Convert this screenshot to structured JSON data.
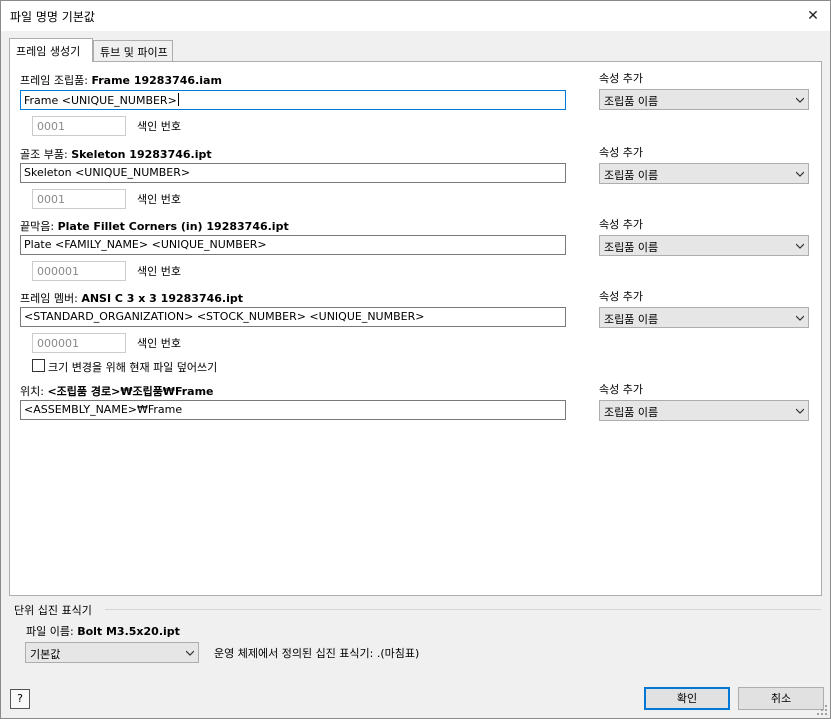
{
  "window": {
    "title": "파일 명명 기본값",
    "close_glyph": "✕"
  },
  "tabs": [
    {
      "label": "프레임 생성기"
    },
    {
      "label": "튜브 및 파이프"
    }
  ],
  "rows": [
    {
      "label_prefix": "프레임 조립품:",
      "label_value": "Frame 19283746.iam",
      "value": "Frame <UNIQUE_NUMBER>",
      "index_value": "0001",
      "index_label": "색인 번호",
      "attr_label": "속성 추가",
      "attr_selected": "조립품 이름"
    },
    {
      "label_prefix": "골조 부품:",
      "label_value": "Skeleton 19283746.ipt",
      "value": "Skeleton <UNIQUE_NUMBER>",
      "index_value": "0001",
      "index_label": "색인 번호",
      "attr_label": "속성 추가",
      "attr_selected": "조립품 이름"
    },
    {
      "label_prefix": "끝막음:",
      "label_value": "Plate Fillet Corners (in) 19283746.ipt",
      "value": "Plate <FAMILY_NAME> <UNIQUE_NUMBER>",
      "index_value": "000001",
      "index_label": "색인 번호",
      "attr_label": "속성 추가",
      "attr_selected": "조립품 이름"
    },
    {
      "label_prefix": "프레임 멤버:",
      "label_value": "ANSI C 3 x 3 19283746.ipt",
      "value": "<STANDARD_ORGANIZATION> <STOCK_NUMBER> <UNIQUE_NUMBER>",
      "index_value": "000001",
      "index_label": "색인 번호",
      "attr_label": "속성 추가",
      "attr_selected": "조립품 이름"
    }
  ],
  "overwrite_checkbox": {
    "label": "크기 변경을 위해 현재 파일 덮어쓰기",
    "checked": false
  },
  "location": {
    "label_prefix": "위치:",
    "label_value": "<조립품 경로>₩조립품₩Frame",
    "value": "<ASSEMBLY_NAME>₩Frame",
    "attr_label": "속성 추가",
    "attr_selected": "조립품 이름"
  },
  "unit_separator": {
    "group_title": "단위 십진 표식기",
    "file_name_prefix": "파일 이름:",
    "file_name_value": "Bolt M3.5x20.ipt",
    "selected": "기본값",
    "description": "운영 체제에서 정의된 십진 표식기: .(마침표)"
  },
  "buttons": {
    "ok": "확인",
    "cancel": "취소",
    "help": "?"
  }
}
